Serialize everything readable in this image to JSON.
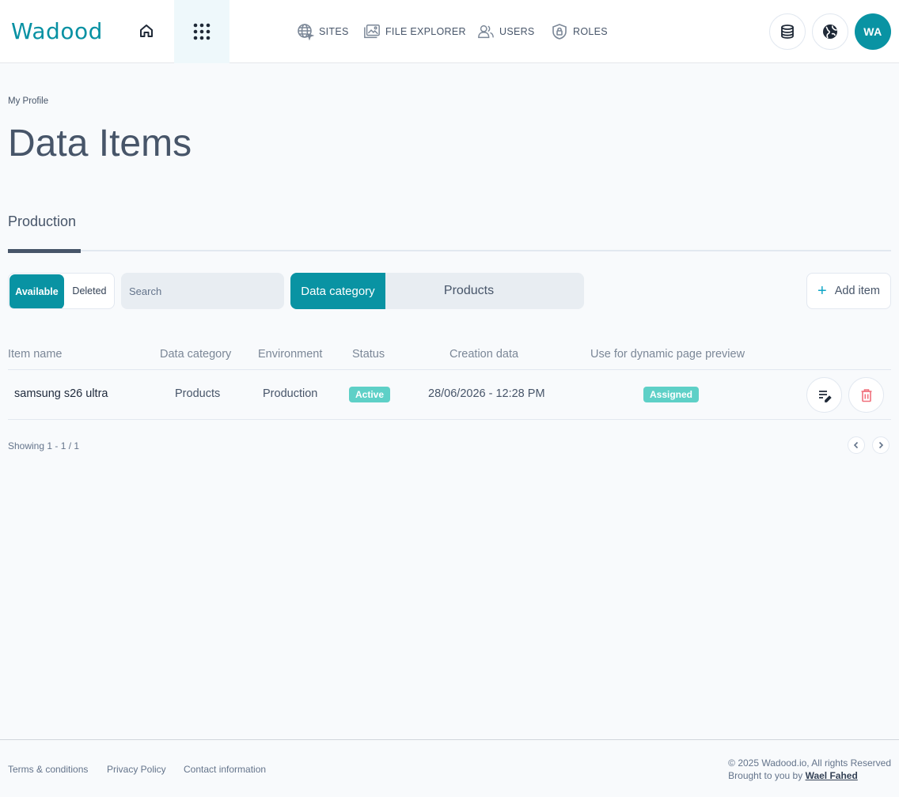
{
  "app": {
    "logo": "Wadood",
    "nav": {
      "sites": "SITES",
      "file_explorer": "FILE EXPLORER",
      "users": "USERS",
      "roles": "ROLES"
    },
    "avatar_initials": "WA",
    "accent_color": "#0993a3"
  },
  "page": {
    "breadcrumb": "My Profile",
    "title": "Data Items",
    "tabs": [
      {
        "label": "Production",
        "active": true
      }
    ]
  },
  "toolbar": {
    "toggle_available": "Available",
    "toggle_deleted": "Deleted",
    "search_placeholder": "Search",
    "category_label": "Data category",
    "category_value": "Products",
    "add_item_label": "Add item"
  },
  "table": {
    "columns": [
      "Item name",
      "Data category",
      "Environment",
      "Status",
      "Creation data",
      "Use for dynamic page preview"
    ],
    "rows": [
      {
        "item_name": "samsung s26 ultra",
        "data_category": "Products",
        "environment": "Production",
        "status": "Active",
        "creation": "28/06/2026 - 12:28 PM",
        "preview": "Assigned"
      }
    ],
    "showing": "Showing 1 - 1 / 1"
  },
  "footer": {
    "links": [
      "Terms & conditions",
      "Privacy Policy",
      "Contact information"
    ],
    "copyright": "© 2025 Wadood.io, All rights Reserved",
    "brought_prefix": "Brought to you by",
    "author": "Wael Fahed"
  }
}
